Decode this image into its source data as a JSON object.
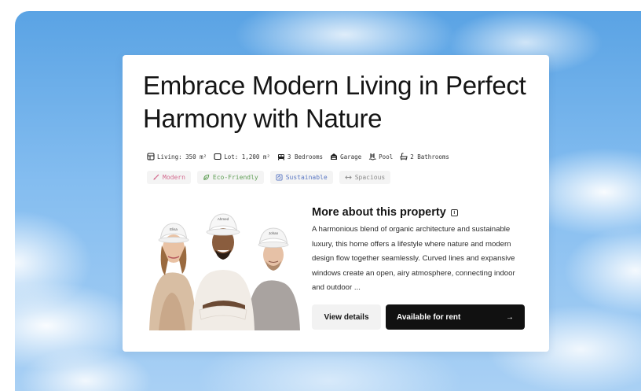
{
  "listing": {
    "title": "Embrace Modern Living in Perfect Harmony with Nature",
    "features": [
      {
        "icon": "living-area-icon",
        "label": "Living: 350 m²"
      },
      {
        "icon": "lot-icon",
        "label": "Lot: 1,200 m²"
      },
      {
        "icon": "bed-icon",
        "label": "3 Bedrooms"
      },
      {
        "icon": "garage-icon",
        "label": "Garage"
      },
      {
        "icon": "pool-icon",
        "label": "Pool"
      },
      {
        "icon": "bath-icon",
        "label": "2 Bathrooms"
      }
    ],
    "tags": [
      {
        "icon": "brush-icon",
        "label": "Modern",
        "color": "#d36a8e"
      },
      {
        "icon": "leaf-icon",
        "label": "Eco-Friendly",
        "color": "#5f9e55"
      },
      {
        "icon": "recycle-icon",
        "label": "Sustainable",
        "color": "#5b78c4"
      },
      {
        "icon": "expand-icon",
        "label": "Spacious",
        "color": "#8a8a8a"
      }
    ],
    "about_title": "More about this property",
    "description": "A harmonious blend of organic architecture and sustainable luxury, this home offers a lifestyle where nature and modern design flow together seamlessly. Curved lines and expansive windows create an open, airy atmosphere, connecting indoor and outdoor ...",
    "photo_helmet_names": [
      "Elisa",
      "Ahmed",
      "Johan"
    ],
    "view_details_label": "View details",
    "rent_label": "Available for rent",
    "rent_arrow": "→"
  }
}
